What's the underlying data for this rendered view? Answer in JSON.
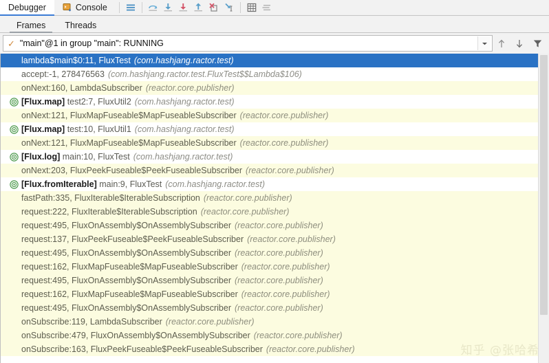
{
  "tabs": [
    {
      "label": "Debugger",
      "icon": "",
      "active": true
    },
    {
      "label": "Console",
      "icon": "console-icon",
      "active": false
    }
  ],
  "toolbar": {
    "buttons": [
      {
        "name": "layout-settings-icon",
        "title": "Layout Settings"
      },
      {
        "name": "step-over-icon",
        "title": "Step Over"
      },
      {
        "name": "step-into-icon",
        "title": "Step Into"
      },
      {
        "name": "force-step-into-icon",
        "title": "Force Step Into"
      },
      {
        "name": "step-out-icon",
        "title": "Step Out"
      },
      {
        "name": "drop-frame-icon",
        "title": "Drop Frame"
      },
      {
        "name": "run-to-cursor-icon",
        "title": "Run to Cursor"
      },
      {
        "name": "evaluate-expression-icon",
        "title": "Evaluate Expression"
      },
      {
        "name": "settings-lines-icon",
        "title": "Settings"
      }
    ]
  },
  "subtabs": [
    {
      "label": "Frames",
      "active": true
    },
    {
      "label": "Threads",
      "active": false
    }
  ],
  "thread_selector": {
    "status_icon": "running-check-icon",
    "value": "\"main\"@1 in group \"main\": RUNNING",
    "dropdown_icon": "chevron-down-icon",
    "controls": [
      {
        "name": "move-up-button",
        "glyph": "↑"
      },
      {
        "name": "move-down-button",
        "glyph": "↓"
      },
      {
        "name": "filter-button",
        "glyph": "filter-icon"
      }
    ]
  },
  "frames": [
    {
      "icon": "none",
      "bold": "",
      "text": "lambda$main$0:11, FluxTest",
      "pkg": "(com.hashjang.ractor.test)",
      "bg": "selected"
    },
    {
      "icon": "none",
      "bold": "",
      "text": "accept:-1, 278476563",
      "pkg": "(com.hashjang.ractor.test.FluxTest$$Lambda$106)",
      "bg": "white"
    },
    {
      "icon": "none",
      "bold": "",
      "text": "onNext:160, LambdaSubscriber",
      "pkg": "(reactor.core.publisher)",
      "bg": "cream"
    },
    {
      "icon": "reactive-stream-icon",
      "bold": "[Flux.map]",
      "text": "test2:7, FluxUtil2",
      "pkg": "(com.hashjang.ractor.test)",
      "bg": "white"
    },
    {
      "icon": "none",
      "bold": "",
      "text": "onNext:121, FluxMapFuseable$MapFuseableSubscriber",
      "pkg": "(reactor.core.publisher)",
      "bg": "cream"
    },
    {
      "icon": "reactive-stream-icon",
      "bold": "[Flux.map]",
      "text": "test:10, FluxUtil1",
      "pkg": "(com.hashjang.ractor.test)",
      "bg": "white"
    },
    {
      "icon": "none",
      "bold": "",
      "text": "onNext:121, FluxMapFuseable$MapFuseableSubscriber",
      "pkg": "(reactor.core.publisher)",
      "bg": "cream"
    },
    {
      "icon": "reactive-stream-icon",
      "bold": "[Flux.log]",
      "text": "main:10, FluxTest",
      "pkg": "(com.hashjang.ractor.test)",
      "bg": "white"
    },
    {
      "icon": "none",
      "bold": "",
      "text": "onNext:203, FluxPeekFuseable$PeekFuseableSubscriber",
      "pkg": "(reactor.core.publisher)",
      "bg": "cream"
    },
    {
      "icon": "reactive-stream-icon",
      "bold": "[Flux.fromIterable]",
      "text": "main:9, FluxTest",
      "pkg": "(com.hashjang.ractor.test)",
      "bg": "white"
    },
    {
      "icon": "none",
      "bold": "",
      "text": "fastPath:335, FluxIterable$IterableSubscription",
      "pkg": "(reactor.core.publisher)",
      "bg": "cream"
    },
    {
      "icon": "none",
      "bold": "",
      "text": "request:222, FluxIterable$IterableSubscription",
      "pkg": "(reactor.core.publisher)",
      "bg": "cream"
    },
    {
      "icon": "none",
      "bold": "",
      "text": "request:495, FluxOnAssembly$OnAssemblySubscriber",
      "pkg": "(reactor.core.publisher)",
      "bg": "cream"
    },
    {
      "icon": "none",
      "bold": "",
      "text": "request:137, FluxPeekFuseable$PeekFuseableSubscriber",
      "pkg": "(reactor.core.publisher)",
      "bg": "cream"
    },
    {
      "icon": "none",
      "bold": "",
      "text": "request:495, FluxOnAssembly$OnAssemblySubscriber",
      "pkg": "(reactor.core.publisher)",
      "bg": "cream"
    },
    {
      "icon": "none",
      "bold": "",
      "text": "request:162, FluxMapFuseable$MapFuseableSubscriber",
      "pkg": "(reactor.core.publisher)",
      "bg": "cream"
    },
    {
      "icon": "none",
      "bold": "",
      "text": "request:495, FluxOnAssembly$OnAssemblySubscriber",
      "pkg": "(reactor.core.publisher)",
      "bg": "cream"
    },
    {
      "icon": "none",
      "bold": "",
      "text": "request:162, FluxMapFuseable$MapFuseableSubscriber",
      "pkg": "(reactor.core.publisher)",
      "bg": "cream"
    },
    {
      "icon": "none",
      "bold": "",
      "text": "request:495, FluxOnAssembly$OnAssemblySubscriber",
      "pkg": "(reactor.core.publisher)",
      "bg": "cream"
    },
    {
      "icon": "none",
      "bold": "",
      "text": "onSubscribe:119, LambdaSubscriber",
      "pkg": "(reactor.core.publisher)",
      "bg": "cream"
    },
    {
      "icon": "none",
      "bold": "",
      "text": "onSubscribe:479, FluxOnAssembly$OnAssemblySubscriber",
      "pkg": "(reactor.core.publisher)",
      "bg": "cream"
    },
    {
      "icon": "none",
      "bold": "",
      "text": "onSubscribe:163, FluxPeekFuseable$PeekFuseableSubscriber",
      "pkg": "(reactor.core.publisher)",
      "bg": "cream"
    }
  ],
  "watermark": "知乎 @张哈希",
  "colors": {
    "selection": "#2a72c4",
    "cream_row": "#fcfce0",
    "reactive_icon": "#4e9a4e",
    "check": "#d08a3e"
  }
}
